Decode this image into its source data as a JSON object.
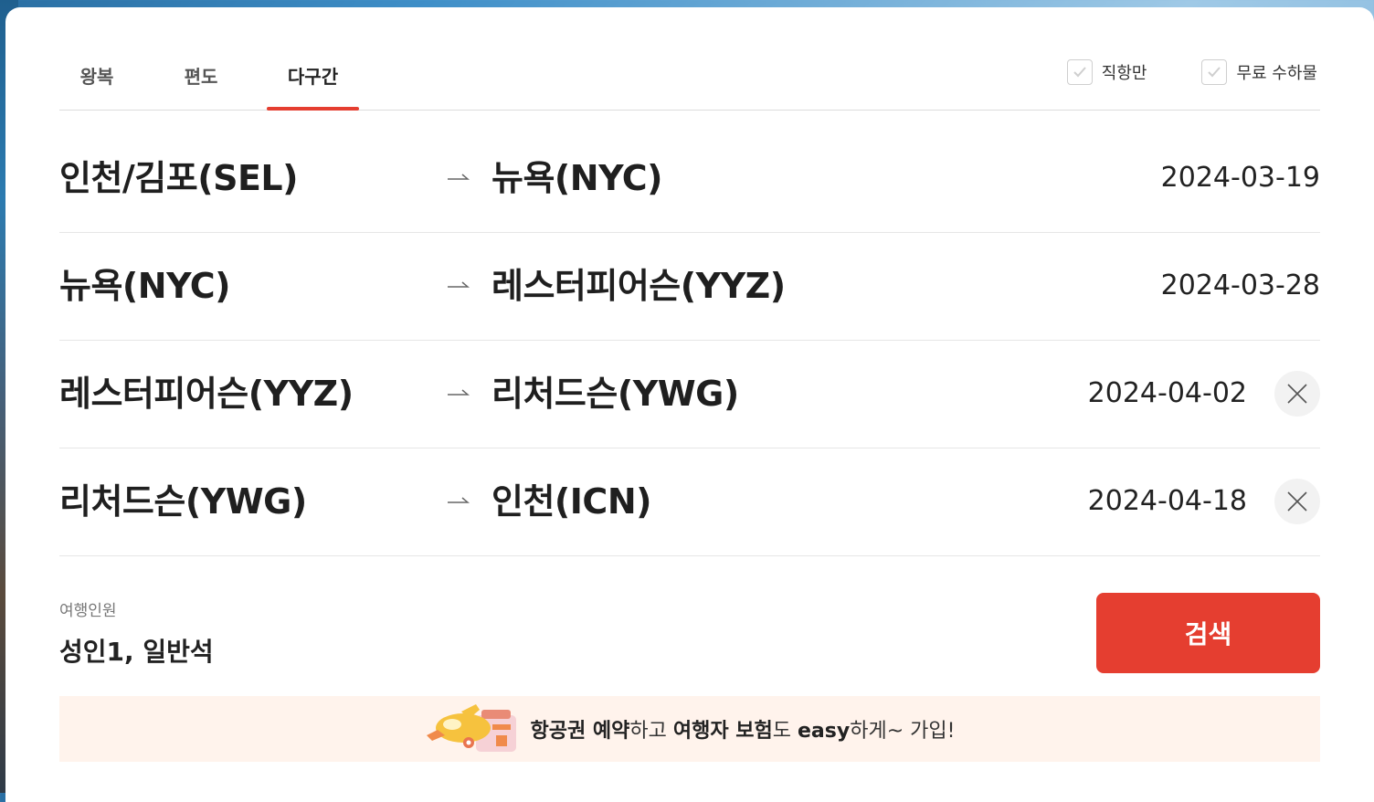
{
  "tabs": [
    {
      "label": "왕복",
      "active": false
    },
    {
      "label": "편도",
      "active": false
    },
    {
      "label": "다구간",
      "active": true
    }
  ],
  "options": {
    "direct_only": "직항만",
    "free_baggage": "무료 수하물"
  },
  "segments": [
    {
      "from": "인천/김포(SEL)",
      "to": "뉴욕(NYC)",
      "date": "2024-03-19",
      "removable": false
    },
    {
      "from": "뉴욕(NYC)",
      "to": "레스터피어슨(YYZ)",
      "date": "2024-03-28",
      "removable": false
    },
    {
      "from": "레스터피어슨(YYZ)",
      "to": "리처드슨(YWG)",
      "date": "2024-04-02",
      "removable": true
    },
    {
      "from": "리처드슨(YWG)",
      "to": "인천(ICN)",
      "date": "2024-04-18",
      "removable": true
    }
  ],
  "travelers": {
    "label": "여행인원",
    "value": "성인1, 일반석"
  },
  "search_label": "검색",
  "banner": {
    "p1": "항공권 예약",
    "p2": "하고 ",
    "p3": "여행자 보험",
    "p4": "도 ",
    "p5": "easy",
    "p6": "하게~ 가입!"
  },
  "colors": {
    "accent": "#e53e30",
    "banner_bg": "#fff3ec"
  }
}
